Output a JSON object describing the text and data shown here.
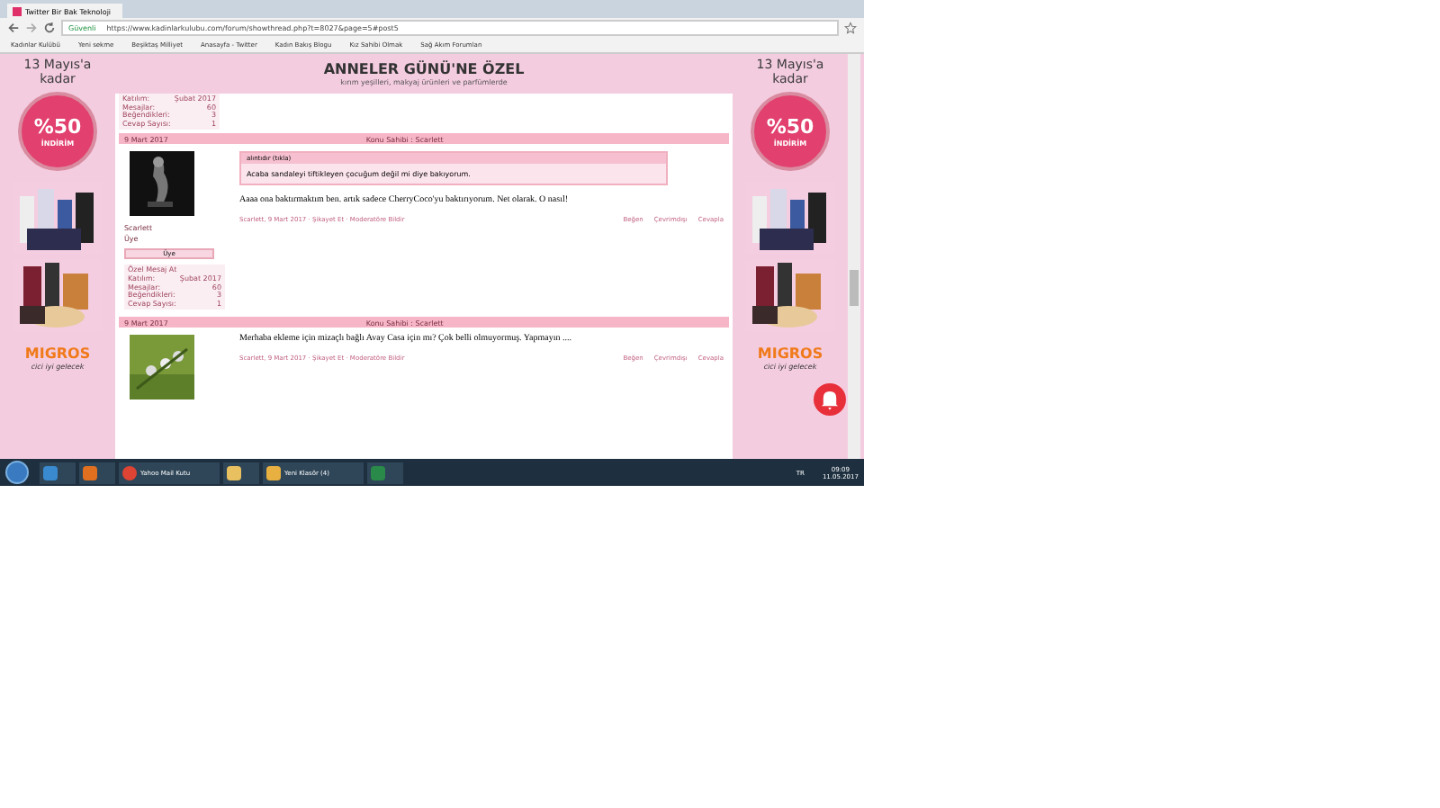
{
  "browser": {
    "tab_title": "Twitter Bir Bak Teknoloji",
    "url_secure": "Güvenli",
    "url": "https://www.kadinlarkulubu.com/forum/showthread.php?t=8027&page=5#post5",
    "bookmarks": [
      "Kadınlar Kulübü",
      "Yeni sekme",
      "Beşiktaş Milliyet",
      "Anasayfa - Twitter",
      "Kadın Bakış Blogu",
      "Kız Sahibi Olmak",
      "Sağ Akım Forumları"
    ]
  },
  "ads": [
    {
      "date": "13 Mayıs'a",
      "until": "kadar",
      "percent": "%50",
      "discount": "İNDİRİM",
      "brand": "MIGROS",
      "slogan": "cici iyi gelecek"
    },
    {
      "date": "13 Mayıs'a",
      "until": "kadar",
      "percent": "%50",
      "discount": "İNDİRİM",
      "brand": "MIGROS",
      "slogan": "cici iyi gelecek"
    }
  ],
  "banner": {
    "title": "ANNELER GÜNÜ'NE ÖZEL",
    "subtitle": "kırım yeşilleri, makyaj ürünleri ve parfümlerde"
  },
  "top_stats": [
    {
      "label": "Katılım:",
      "value": "Şubat 2017"
    },
    {
      "label": "Mesajlar:",
      "value": "60"
    },
    {
      "label": "Beğendikleri:",
      "value": "3"
    },
    {
      "label": "Cevap Sayısı:",
      "value": "1"
    }
  ],
  "posts": [
    {
      "date": "9 Mart 2017",
      "owner": "Konu Sahibi : Scarlett",
      "quote_header": "alıntıdır (tıkla)",
      "quote": "Acaba sandaleyi tiftikleyen çocuğum değil mi diye bakıyorum.",
      "text": "Aaaa ona baktırmaktım ben. artık sadece CherryCoco'yu baktırıyorum. Net olarak. O nasıl!",
      "meta": "Scarlett, 9 Mart 2017 · Şikayet Et · Moderatöre Bildir",
      "actions": [
        "Beğen",
        "Çevrimdışı",
        "Cevapla"
      ],
      "user": "Scarlett",
      "user_sub": "Üye",
      "button": "Üye",
      "user_stats": [
        {
          "label": "Özel Mesaj At"
        },
        {
          "label": "Katılım:",
          "value": "Şubat 2017"
        },
        {
          "label": "Mesajlar:",
          "value": "60"
        },
        {
          "label": "Beğendikleri:",
          "value": "3"
        },
        {
          "label": "Cevap Sayısı:",
          "value": "1"
        }
      ]
    },
    {
      "date": "9 Mart 2017",
      "owner": "Konu Sahibi : Scarlett",
      "text": "Merhaba ekleme için mizaçlı bağlı Avay Casa için mı? Çok belli olmuyormuş. Yapmayın ....",
      "meta": "Scarlett, 9 Mart 2017 · Şikayet Et · Moderatöre Bildir",
      "actions": [
        "Beğen",
        "Çevrimdışı",
        "Cevapla"
      ]
    }
  ],
  "taskbar": {
    "windows": [
      "Yahoo Mail Kutu",
      "Yeni Klasör (4)"
    ],
    "lang": "TR",
    "time": "09:09",
    "date": "11.05.2017"
  }
}
